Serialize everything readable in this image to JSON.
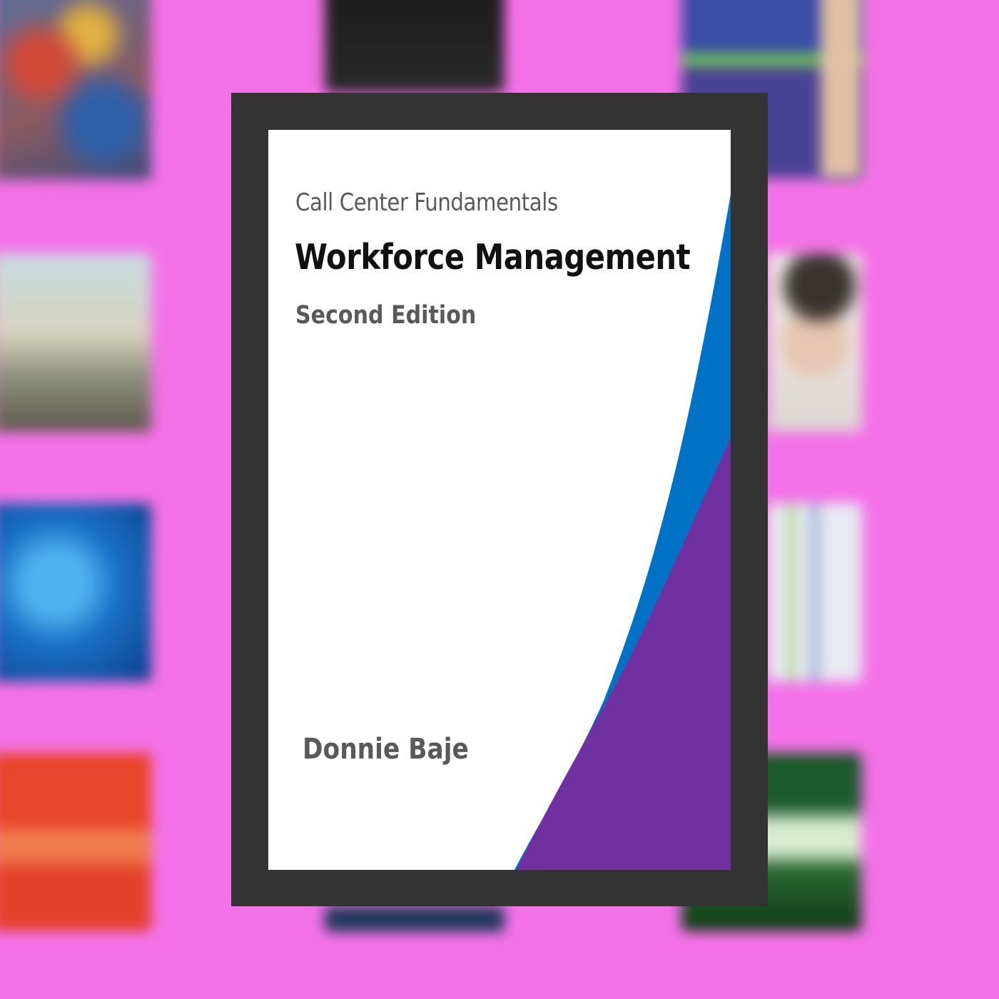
{
  "book": {
    "series": "Call Center Fundamentals",
    "title": "Workforce Management",
    "edition": "Second Edition",
    "author": "Donnie Baje"
  },
  "colors": {
    "background": "#f472e8",
    "frame": "#333333",
    "cover": "#ffffff",
    "accent_blue": "#0072c6",
    "accent_purple": "#7030a0"
  },
  "background_thumbnails": [
    {
      "name": "blurred-cover-colorful-crowd",
      "color": "#6a6a8a"
    },
    {
      "name": "blurred-cover-dark-text",
      "color": "#262626"
    },
    {
      "name": "blurred-cover-purple",
      "color": "#4a4a9a"
    },
    {
      "name": "blurred-cover-city-skyline",
      "color": "#b8b8ae"
    },
    {
      "name": "blurred-cover-person-photo",
      "color": "#d8d0cc"
    },
    {
      "name": "blurred-cover-blue-globe",
      "color": "#1c78c8"
    },
    {
      "name": "blurred-cover-light-chart",
      "color": "#d9dee8"
    },
    {
      "name": "blurred-cover-orange",
      "color": "#e1492a"
    },
    {
      "name": "blurred-cover-dark-blue",
      "color": "#1e3a5f"
    },
    {
      "name": "blurred-cover-green",
      "color": "#1f4d2a"
    }
  ]
}
